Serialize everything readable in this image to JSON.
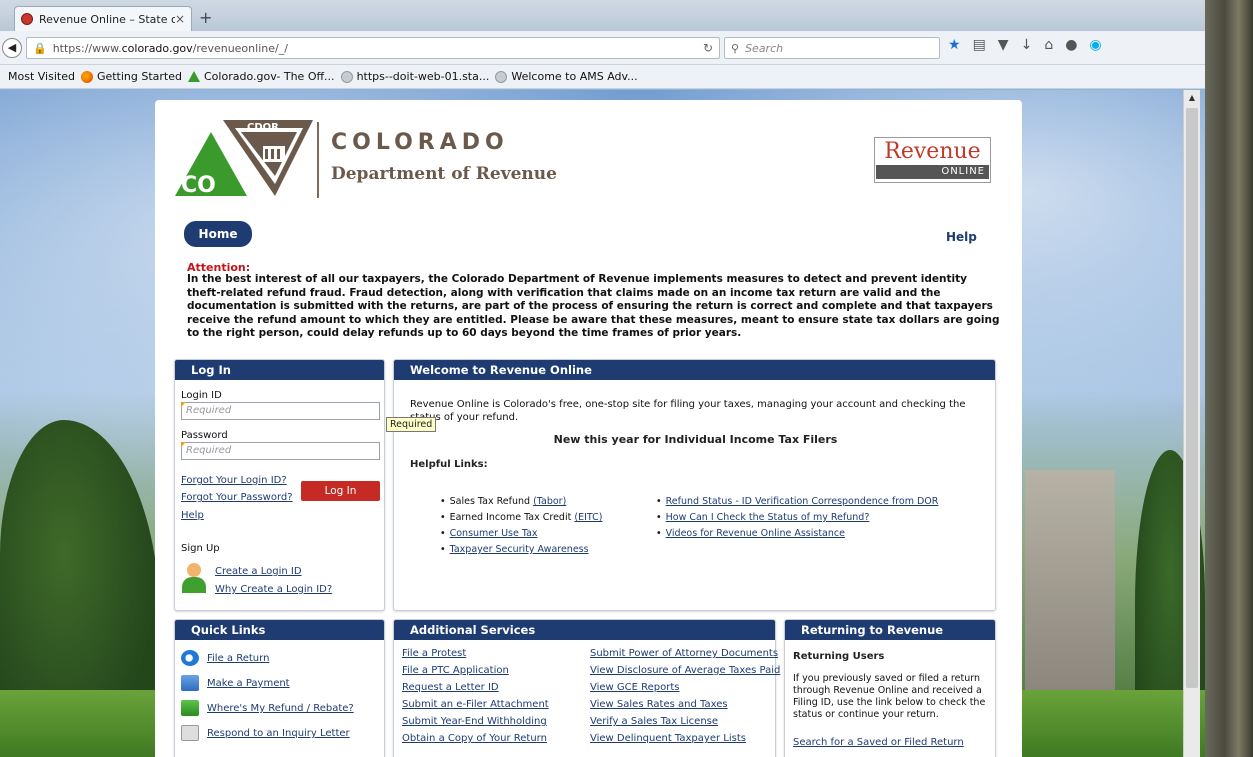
{
  "browser": {
    "tab_title": "Revenue Online – State of ...",
    "tab_close": "×",
    "new_tab": "+",
    "url_prefix": "https://www.",
    "url_domain": "colorado.gov",
    "url_path": "/revenueonline/_/",
    "search_placeholder": "Search",
    "bookmarks": [
      {
        "label": "Most Visited",
        "icon": "none"
      },
      {
        "label": "Getting Started",
        "icon": "firefox-icon"
      },
      {
        "label": "Colorado.gov- The Off...",
        "icon": "colorado-icon"
      },
      {
        "label": "https--doit-web-01.sta...",
        "icon": "globe-icon"
      },
      {
        "label": "Welcome to AMS Adv...",
        "icon": "globe-icon"
      }
    ]
  },
  "header": {
    "logo_cdor": "CDOR",
    "logo_co": "CO",
    "colorado": "COLORADO",
    "department": "Department of Revenue",
    "revenue_word": "Revenue",
    "online_word": "ONLINE"
  },
  "nav": {
    "home": "Home",
    "help": "Help"
  },
  "attention": {
    "title": "Attention:",
    "body": "In the best interest of all our taxpayers, the Colorado Department of Revenue implements measures to detect and prevent identity theft-related refund fraud. Fraud detection, along with verification that claims made on an income tax return are valid and the documentation is submitted with the returns, are part of the process of ensuring the return is correct and complete and that taxpayers receive the refund amount to which they are entitled. Please be aware that these measures, meant to ensure state tax dollars are going to the right person, could delay refunds up to 60 days beyond the time frames of prior years."
  },
  "login": {
    "title": "Log In",
    "login_id_label": "Login ID",
    "login_id_placeholder": "Required",
    "password_label": "Password",
    "password_placeholder": "Required",
    "tooltip": "Required",
    "forgot_id": "Forgot Your Login ID?",
    "forgot_password": "Forgot Your Password?",
    "help": "Help",
    "button": "Log In",
    "sign_up": "Sign Up",
    "create_id": "Create a Login ID",
    "why_create": "Why Create a Login ID?"
  },
  "welcome": {
    "title": "Welcome to Revenue Online",
    "intro": "Revenue Online is Colorado's free, one-stop site for filing your taxes, managing your account and checking the status of your refund.",
    "new_this_year": "New this year for Individual Income Tax Filers",
    "helpful_links": "Helpful Links:",
    "left_links": [
      {
        "text": "Sales Tax Refund ",
        "link": "(Tabor)"
      },
      {
        "text": "Earned Income Tax Credit ",
        "link": "(EITC)"
      },
      {
        "text": "",
        "link": "Consumer Use Tax"
      },
      {
        "text": "",
        "link": "Taxpayer Security Awareness"
      }
    ],
    "right_links": [
      "Refund Status - ID Verification Correspondence from DOR",
      "How Can I Check the Status of my Refund?",
      "Videos for Revenue Online Assistance"
    ]
  },
  "quick_links": {
    "title": "Quick Links",
    "items": [
      {
        "label": "File a Return",
        "icon": "internet-explorer-icon"
      },
      {
        "label": "Make a Payment",
        "icon": "payment-icon"
      },
      {
        "label": "Where's My Refund / Rebate?",
        "icon": "refund-icon"
      },
      {
        "label": "Respond to an Inquiry Letter",
        "icon": "envelope-icon"
      }
    ]
  },
  "additional_services": {
    "title": "Additional Services",
    "left": [
      "File a Protest",
      "File a PTC Application",
      "Request a Letter ID",
      "Submit an e-Filer Attachment",
      "Submit Year-End Withholding",
      "Obtain a Copy of Your Return"
    ],
    "right": [
      "Submit Power of Attorney Documents",
      "View Disclosure of Average Taxes Paid",
      "View GCE Reports",
      "View Sales Rates and Taxes",
      "Verify a Sales Tax License",
      "View Delinquent Taxpayer Lists"
    ]
  },
  "returning": {
    "title": "Returning to Revenue Online?",
    "heading": "Returning Users",
    "body": "If you previously saved or filed a return through Revenue Online and received a Filing ID, use the link below to check the status or continue your return.",
    "link": "Search for a Saved or Filed Return"
  },
  "colors": {
    "navy": "#1e3c72",
    "red": "#c62a24",
    "brown": "#6b5a4c",
    "green": "#3a9a2b"
  }
}
